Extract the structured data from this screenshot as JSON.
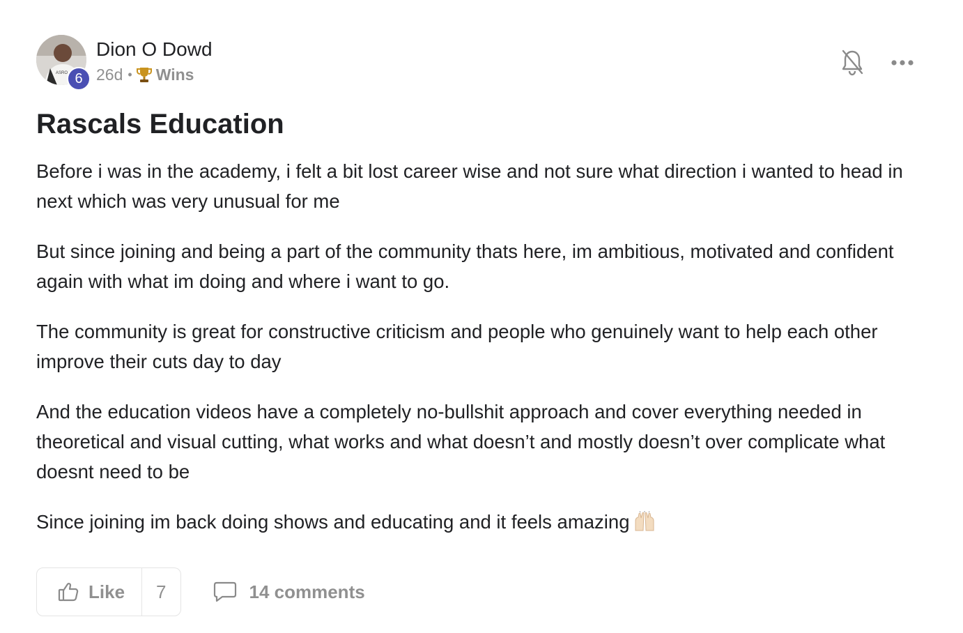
{
  "post": {
    "author": "Dion O Dowd",
    "level": "6",
    "time_ago": "26d",
    "separator": "•",
    "category": "Wins",
    "title": "Rascals Education",
    "paragraphs": [
      "Before i was in the academy, i felt a bit lost career wise and not sure what direction i wanted to head in next which was very unusual for me",
      "But since joining and being a part of the community thats here, im ambitious, motivated and confident again with what im doing and where i want to go.",
      "The community is great for constructive criticism and people who genuinely want to help each other improve their cuts day to day",
      "And the education videos have a completely no-bullshit approach and cover everything needed in theoretical and visual cutting, what works and what doesn’t and mostly doesn’t over complicate what doesnt need to be",
      "Since joining im back doing shows and educating and it feels amazing"
    ],
    "like_label": "Like",
    "like_count": "7",
    "comments_label": "14 comments"
  },
  "icons": {
    "category": "trophy-icon",
    "notifications": "bell-off-icon",
    "more": "more-options-icon",
    "emoji": "raising-hands-emoji-icon",
    "like": "thumbs-up-icon",
    "comments": "comment-bubble-icon"
  },
  "colors": {
    "level_badge": "#4a4fb3",
    "muted_text": "#909090",
    "text": "#202124",
    "border": "#e4e4e4"
  }
}
